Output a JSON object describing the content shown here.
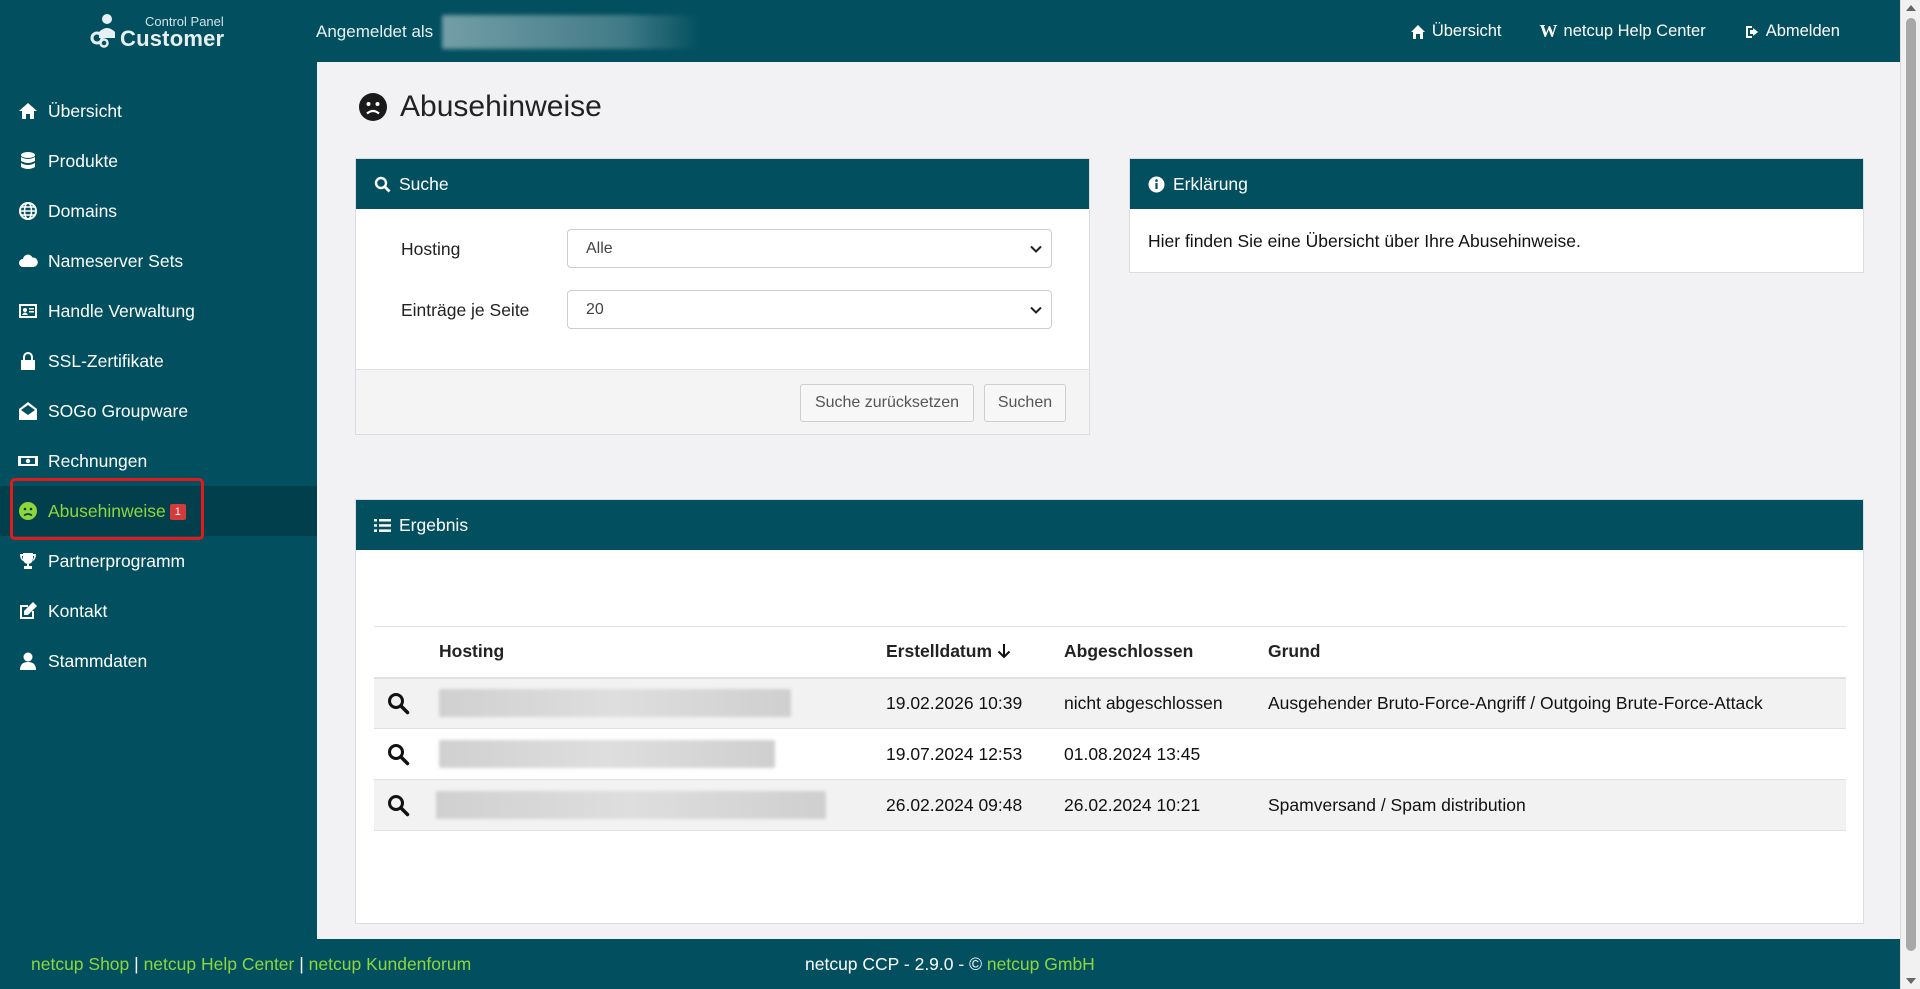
{
  "app": {
    "logo_small": "Control Panel",
    "logo_big": "Customer",
    "logged_in_label": "Angemeldet als"
  },
  "topnav": {
    "overview": "Übersicht",
    "help": "netcup Help Center",
    "logout": "Abmelden"
  },
  "sidebar": {
    "items": [
      {
        "label": "Übersicht",
        "icon": "home-icon"
      },
      {
        "label": "Produkte",
        "icon": "database-icon"
      },
      {
        "label": "Domains",
        "icon": "globe-icon"
      },
      {
        "label": "Nameserver Sets",
        "icon": "cloud-icon"
      },
      {
        "label": "Handle Verwaltung",
        "icon": "id-card-icon"
      },
      {
        "label": "SSL-Zertifikate",
        "icon": "lock-icon"
      },
      {
        "label": "SOGo Groupware",
        "icon": "envelope-open-icon"
      },
      {
        "label": "Rechnungen",
        "icon": "money-bill-icon"
      },
      {
        "label": "Abusehinweise",
        "icon": "frown-icon",
        "badge": "1",
        "active": true
      },
      {
        "label": "Partnerprogramm",
        "icon": "trophy-icon"
      },
      {
        "label": "Kontakt",
        "icon": "edit-icon"
      },
      {
        "label": "Stammdaten",
        "icon": "user-icon"
      }
    ]
  },
  "page": {
    "title": "Abusehinweise"
  },
  "search": {
    "header": "Suche",
    "hosting_label": "Hosting",
    "hosting_value": "Alle",
    "per_page_label": "Einträge je Seite",
    "per_page_value": "20",
    "reset_button": "Suche zurücksetzen",
    "search_button": "Suchen"
  },
  "info": {
    "header": "Erklärung",
    "text": "Hier finden Sie eine Übersicht über Ihre Abusehinweise."
  },
  "result": {
    "header": "Ergebnis",
    "columns": {
      "hosting": "Hosting",
      "created": "Erstelldatum",
      "closed": "Abgeschlossen",
      "reason": "Grund"
    },
    "rows": [
      {
        "created": "19.02.2026 10:39",
        "closed": "nicht abgeschlossen",
        "reason": "Ausgehender Bruto-Force-Angriff / Outgoing Brute-Force-Attack"
      },
      {
        "created": "19.07.2024 12:53",
        "closed": "01.08.2024 13:45",
        "reason": ""
      },
      {
        "created": "26.02.2024 09:48",
        "closed": "26.02.2024 10:21",
        "reason": "Spamversand / Spam distribution"
      }
    ]
  },
  "footer": {
    "shop": "netcup Shop",
    "sep1": "|",
    "help": "netcup Help Center",
    "sep2": "|",
    "forum": "netcup Kundenforum",
    "copy_prefix": "netcup CCP - 2.9.0 - ©",
    "company": "netcup GmbH"
  },
  "colors": {
    "primary": "#024f5f",
    "accent": "#8ed63a",
    "badge": "#d43b3b",
    "highlight": "#e11b1b"
  }
}
